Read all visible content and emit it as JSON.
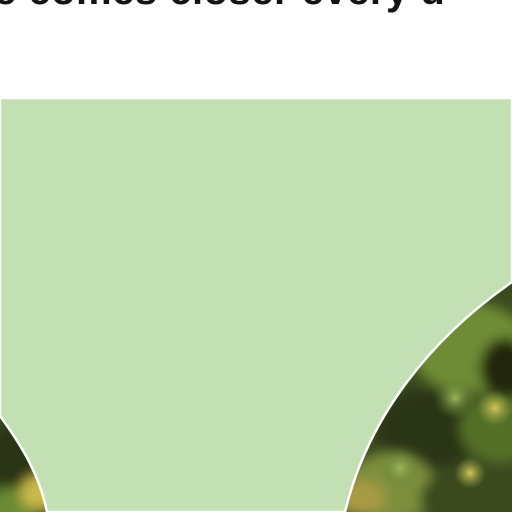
{
  "headline": {
    "text": "e comes closer every d"
  },
  "colors": {
    "background": "#ffffff",
    "headline_text": "#141414",
    "panel_fill": "#c2e0b3",
    "panel_edge": "#ffffff",
    "foliage_dark": "#2b3517",
    "foliage_mid": "#5b7a2e",
    "foliage_light": "#8fa84a",
    "foliage_highlight": "#c9b94a"
  },
  "images": {
    "foliage_photo": "blurred-green-foliage"
  }
}
